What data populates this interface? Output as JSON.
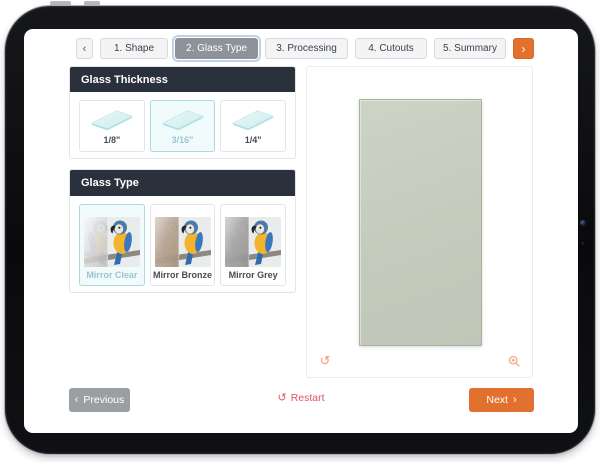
{
  "stepper": {
    "back_icon": "‹",
    "forward_icon": "›",
    "active_step": "2. Glass Type",
    "steps": [
      {
        "label": "1. Shape"
      },
      {
        "label": "2. Glass Type"
      },
      {
        "label": "3. Processing"
      },
      {
        "label": "4. Cutouts"
      },
      {
        "label": "5. Summary"
      }
    ]
  },
  "glass_thickness": {
    "title": "Glass Thickness",
    "selected": "3/16\"",
    "options": [
      {
        "label": "1/8\""
      },
      {
        "label": "3/16\""
      },
      {
        "label": "1/4\""
      }
    ]
  },
  "glass_type": {
    "title": "Glass Type",
    "selected": "Mirror Clear",
    "options": [
      {
        "label": "Mirror Clear",
        "mirror_tint": "#d8d8d8"
      },
      {
        "label": "Mirror Bronze",
        "mirror_tint": "#b19d89"
      },
      {
        "label": "Mirror Grey",
        "mirror_tint": "#9d9d9d"
      }
    ]
  },
  "preview": {
    "glass_color": "#c5cbbc",
    "reset_icon": "↺"
  },
  "footer": {
    "prev_chevron": "‹",
    "previous_label": "Previous",
    "restart_icon": "↺",
    "restart_label": "Restart",
    "next_label": "Next",
    "next_chevron": "›"
  },
  "colors": {
    "accent_orange": "#e2712e",
    "panel_header_dark": "#2b313c",
    "selected_teal": "#a8dade",
    "restart_red": "#e25563",
    "previous_gray": "#9b9fa4",
    "preview_glass": "#c5cbbc"
  }
}
